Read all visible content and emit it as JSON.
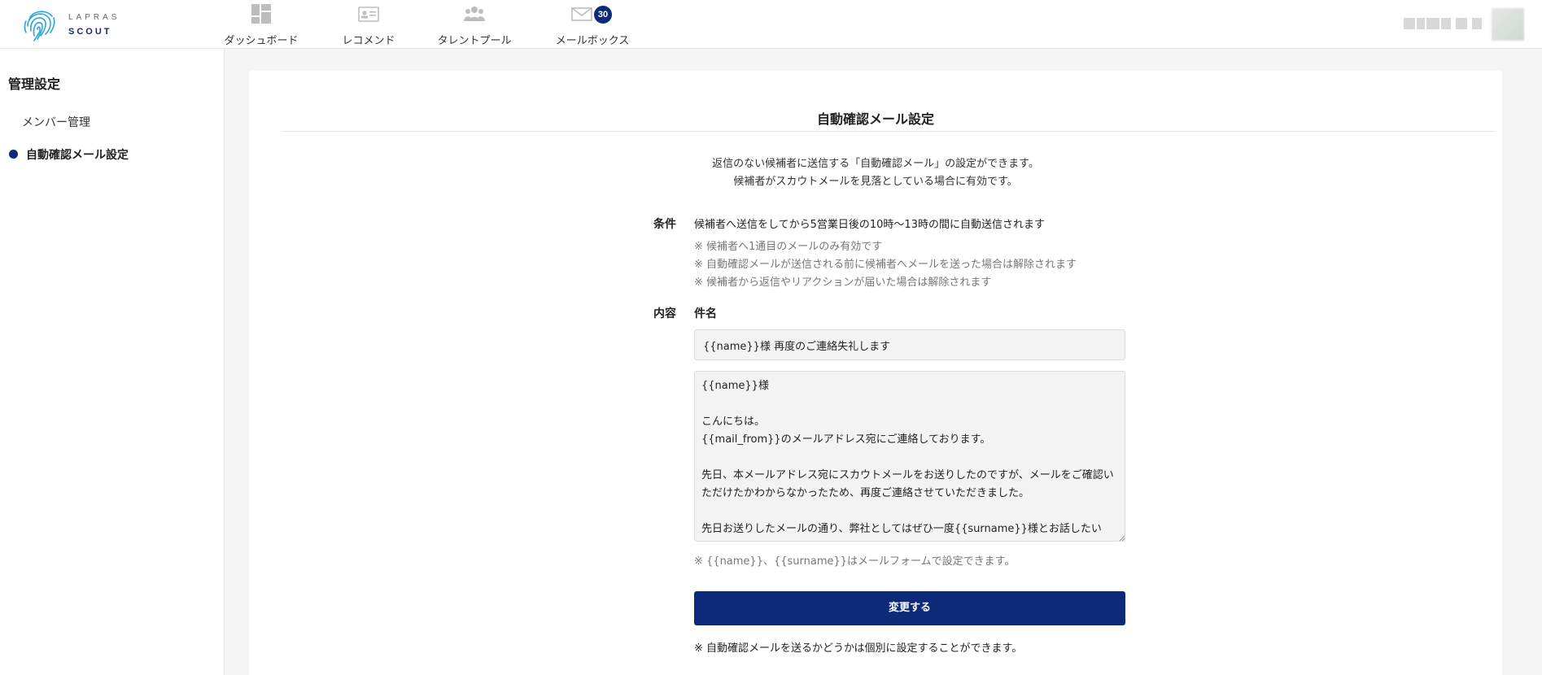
{
  "colors": {
    "brand": "#0d2a7a",
    "background": "#f5f5f5",
    "input_bg": "#f3f3f3"
  },
  "header": {
    "logo": {
      "line1": "LAPRAS",
      "line2": "SCOUT",
      "icon": "fingerprint-icon"
    },
    "nav": [
      {
        "label": "ダッシュボード",
        "icon": "dashboard-icon"
      },
      {
        "label": "レコメンド",
        "icon": "id-card-icon"
      },
      {
        "label": "タレントプール",
        "icon": "people-icon"
      },
      {
        "label": "メールボックス",
        "icon": "mail-icon",
        "badge": "30"
      }
    ]
  },
  "sidebar": {
    "title": "管理設定",
    "items": [
      {
        "label": "メンバー管理",
        "active": false
      },
      {
        "label": "自動確認メール設定",
        "active": true
      }
    ]
  },
  "main": {
    "title": "自動確認メール設定",
    "intro_line1": "返信のない候補者に送信する「自動確認メール」の設定ができます。",
    "intro_line2": "候補者がスカウトメールを見落としている場合に有効です。",
    "condition": {
      "label": "条件",
      "text": "候補者へ送信をしてから5営業日後の10時〜13時の間に自動送信されます",
      "notes": [
        "※ 候補者へ1通目のメールのみ有効です",
        "※ 自動確認メールが送信される前に候補者へメールを送った場合は解除されます",
        "※ 候補者から返信やリアクションが届いた場合は解除されます"
      ]
    },
    "content": {
      "label": "内容",
      "subject_label": "件名",
      "subject_value": "{{name}}様 再度のご連絡失礼します",
      "body_value": "{{name}}様\n\nこんにちは。\n{{mail_from}}のメールアドレス宛にご連絡しております。\n\n先日、本メールアドレス宛にスカウトメールをお送りしたのですが、メールをご確認いただけたかわからなかったため、再度ご連絡させていただきました。\n\n先日お送りしたメールの通り、弊社としてはぜひ一度{{surname}}様とお話したい",
      "hint": "※ {{name}}、{{surname}}はメールフォームで設定できます。"
    },
    "submit_label": "変更する",
    "footnote": "※ 自動確認メールを送るかどうかは個別に設定することができます。"
  }
}
